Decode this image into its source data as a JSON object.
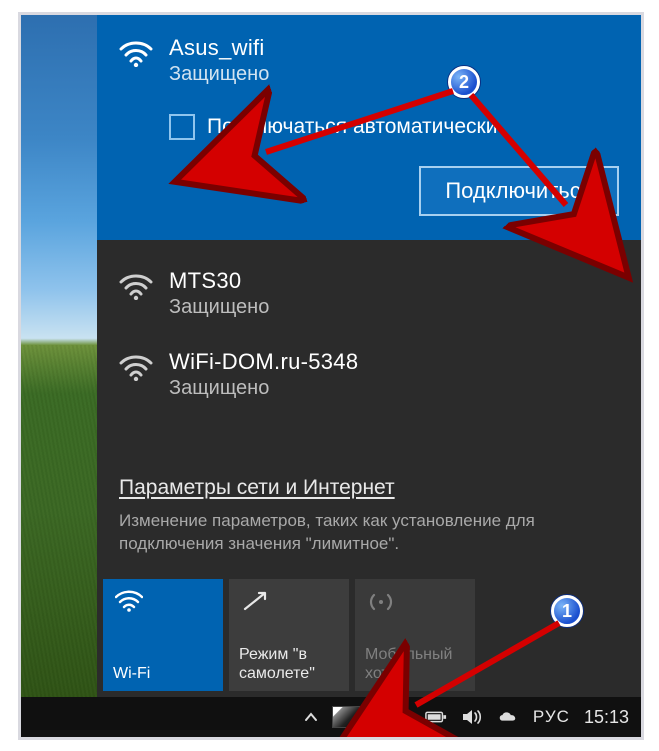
{
  "selected_network": {
    "name": "Asus_wifi",
    "status": "Защищено",
    "auto_connect_label": "Подключаться автоматически",
    "connect_label": "Подключиться"
  },
  "networks": [
    {
      "name": "MTS30",
      "status": "Защищено"
    },
    {
      "name": "WiFi-DOM.ru-5348",
      "status": "Защищено"
    }
  ],
  "settings": {
    "link": "Параметры сети и Интернет",
    "desc": "Изменение параметров, таких как установление для подключения значения \"лимитное\"."
  },
  "tiles": {
    "wifi": "Wi-Fi",
    "airplane": "Режим \"в самолете\"",
    "hotspot_line1": "Мобильный",
    "hotspot_line2": "хот-..."
  },
  "taskbar": {
    "lang": "РУС",
    "clock": "15:13"
  },
  "badges": {
    "one": "1",
    "two": "2"
  },
  "icons": {
    "wifi": "wifi-icon",
    "airplane": "airplane-icon",
    "hotspot": "hotspot-icon",
    "battery": "battery-icon",
    "speaker": "speaker-icon",
    "onedrive": "onedrive-icon",
    "chevron": "chevron-up-icon"
  }
}
